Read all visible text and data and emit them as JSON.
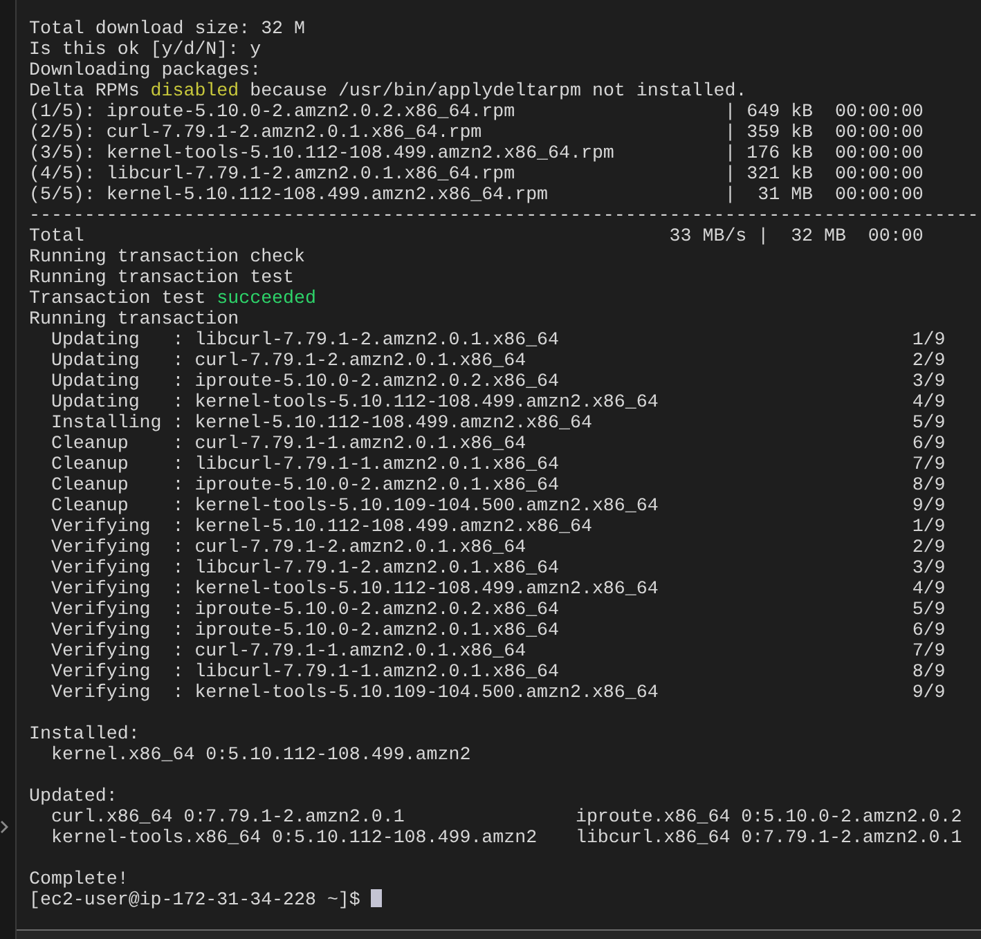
{
  "terminal": {
    "lines": [
      {
        "kind": "text",
        "parts": [
          {
            "text": "Total download size: 32 M"
          }
        ]
      },
      {
        "kind": "text",
        "parts": [
          {
            "text": "Is this ok [y/d/N]: y"
          }
        ]
      },
      {
        "kind": "text",
        "parts": [
          {
            "text": "Downloading packages:"
          }
        ]
      },
      {
        "kind": "text",
        "parts": [
          {
            "text": "Delta RPMs "
          },
          {
            "text": "disabled",
            "color": "#c8c83c"
          },
          {
            "text": " because /usr/bin/applydeltarpm not installed."
          }
        ]
      },
      {
        "kind": "download",
        "text": "(1/5): iproute-5.10.0-2.amzn2.0.2.x86_64.rpm",
        "right": "| 649 kB  00:00:00"
      },
      {
        "kind": "download",
        "text": "(2/5): curl-7.79.1-2.amzn2.0.1.x86_64.rpm",
        "right": "| 359 kB  00:00:00"
      },
      {
        "kind": "download",
        "text": "(3/5): kernel-tools-5.10.112-108.499.amzn2.x86_64.rpm",
        "right": "| 176 kB  00:00:00"
      },
      {
        "kind": "download",
        "text": "(4/5): libcurl-7.79.1-2.amzn2.0.1.x86_64.rpm",
        "right": "| 321 kB  00:00:00"
      },
      {
        "kind": "download",
        "text": "(5/5): kernel-5.10.112-108.499.amzn2.x86_64.rpm",
        "right": "|  31 MB  00:00:00"
      },
      {
        "kind": "text",
        "parts": [
          {
            "text": "--------------------------------------------------------------------------------------"
          }
        ]
      },
      {
        "kind": "download",
        "text": "Total",
        "right": "33 MB/s |  32 MB  00:00"
      },
      {
        "kind": "text",
        "parts": [
          {
            "text": "Running transaction check"
          }
        ]
      },
      {
        "kind": "text",
        "parts": [
          {
            "text": "Running transaction test"
          }
        ]
      },
      {
        "kind": "text",
        "parts": [
          {
            "text": "Transaction test "
          },
          {
            "text": "succeeded",
            "color": "#2ed46a"
          }
        ]
      },
      {
        "kind": "text",
        "parts": [
          {
            "text": "Running transaction"
          }
        ]
      },
      {
        "kind": "step",
        "text": "  Updating   : libcurl-7.79.1-2.amzn2.0.1.x86_64",
        "right": "1/9"
      },
      {
        "kind": "step",
        "text": "  Updating   : curl-7.79.1-2.amzn2.0.1.x86_64",
        "right": "2/9"
      },
      {
        "kind": "step",
        "text": "  Updating   : iproute-5.10.0-2.amzn2.0.2.x86_64",
        "right": "3/9"
      },
      {
        "kind": "step",
        "text": "  Updating   : kernel-tools-5.10.112-108.499.amzn2.x86_64",
        "right": "4/9"
      },
      {
        "kind": "step",
        "text": "  Installing : kernel-5.10.112-108.499.amzn2.x86_64",
        "right": "5/9"
      },
      {
        "kind": "step",
        "text": "  Cleanup    : curl-7.79.1-1.amzn2.0.1.x86_64",
        "right": "6/9"
      },
      {
        "kind": "step",
        "text": "  Cleanup    : libcurl-7.79.1-1.amzn2.0.1.x86_64",
        "right": "7/9"
      },
      {
        "kind": "step",
        "text": "  Cleanup    : iproute-5.10.0-2.amzn2.0.1.x86_64",
        "right": "8/9"
      },
      {
        "kind": "step",
        "text": "  Cleanup    : kernel-tools-5.10.109-104.500.amzn2.x86_64",
        "right": "9/9"
      },
      {
        "kind": "step",
        "text": "  Verifying  : kernel-5.10.112-108.499.amzn2.x86_64",
        "right": "1/9"
      },
      {
        "kind": "step",
        "text": "  Verifying  : curl-7.79.1-2.amzn2.0.1.x86_64",
        "right": "2/9"
      },
      {
        "kind": "step",
        "text": "  Verifying  : libcurl-7.79.1-2.amzn2.0.1.x86_64",
        "right": "3/9"
      },
      {
        "kind": "step",
        "text": "  Verifying  : kernel-tools-5.10.112-108.499.amzn2.x86_64",
        "right": "4/9"
      },
      {
        "kind": "step",
        "text": "  Verifying  : iproute-5.10.0-2.amzn2.0.2.x86_64",
        "right": "5/9"
      },
      {
        "kind": "step",
        "text": "  Verifying  : iproute-5.10.0-2.amzn2.0.1.x86_64",
        "right": "6/9"
      },
      {
        "kind": "step",
        "text": "  Verifying  : curl-7.79.1-1.amzn2.0.1.x86_64",
        "right": "7/9"
      },
      {
        "kind": "step",
        "text": "  Verifying  : libcurl-7.79.1-1.amzn2.0.1.x86_64",
        "right": "8/9"
      },
      {
        "kind": "step",
        "text": "  Verifying  : kernel-tools-5.10.109-104.500.amzn2.x86_64",
        "right": "9/9"
      },
      {
        "kind": "blank"
      },
      {
        "kind": "text",
        "parts": [
          {
            "text": "Installed:"
          }
        ]
      },
      {
        "kind": "text",
        "parts": [
          {
            "text": "  kernel.x86_64 0:5.10.112-108.499.amzn2"
          }
        ]
      },
      {
        "kind": "blank"
      },
      {
        "kind": "text",
        "parts": [
          {
            "text": "Updated:"
          }
        ]
      },
      {
        "kind": "columns",
        "cells": [
          "  curl.x86_64 0:7.79.1-2.amzn2.0.1",
          "iproute.x86_64 0:5.10.0-2.amzn2.0.2"
        ]
      },
      {
        "kind": "columns",
        "cells": [
          "  kernel-tools.x86_64 0:5.10.112-108.499.amzn2",
          "libcurl.x86_64 0:7.79.1-2.amzn2.0.1"
        ]
      },
      {
        "kind": "blank"
      },
      {
        "kind": "text",
        "parts": [
          {
            "text": "Complete!"
          }
        ]
      },
      {
        "kind": "prompt",
        "text": "[ec2-user@ip-172-31-34-228 ~]$",
        "cursor": true
      }
    ]
  }
}
